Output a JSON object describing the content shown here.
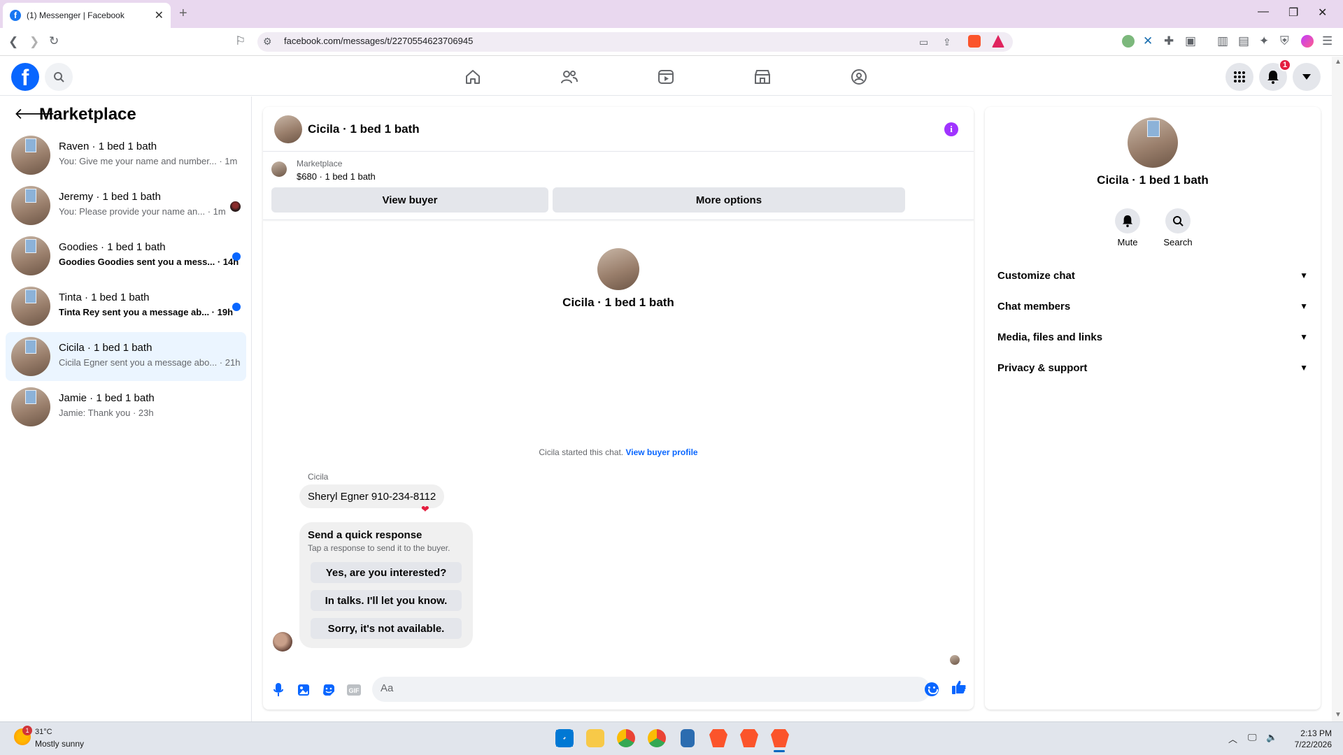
{
  "browser": {
    "tab_title": "(1) Messenger | Facebook",
    "url": "facebook.com/messages/t/2270554623706945"
  },
  "header": {
    "notification_count": "1"
  },
  "left_panel": {
    "title": "Marketplace",
    "conversations": [
      {
        "name": "Raven · 1 bed 1 bath",
        "preview": "You: Give me your name and number... · 1m",
        "unread": false
      },
      {
        "name": "Jeremy · 1 bed 1 bath",
        "preview": "You: Please provide your name an... · 1m",
        "unread": false
      },
      {
        "name": "Goodies · 1 bed 1 bath",
        "preview": "Goodies Goodies sent you a mess... · 14h",
        "unread": true
      },
      {
        "name": "Tinta · 1 bed 1 bath",
        "preview": "Tinta Rey sent you a message ab... · 19h",
        "unread": true
      },
      {
        "name": "Cicila · 1 bed 1 bath",
        "preview": "Cicila Egner sent you a message abo... · 21h",
        "unread": false
      },
      {
        "name": "Jamie · 1 bed 1 bath",
        "preview": "Jamie: Thank you · 23h",
        "unread": false
      }
    ]
  },
  "chat": {
    "title": "Cicila · 1 bed 1 bath",
    "marketplace_label": "Marketplace",
    "listing": "$680 · 1 bed 1 bath",
    "view_buyer": "View buyer",
    "more_options": "More options",
    "profile_name": "Cicila · 1 bed 1 bath",
    "started_text": "Cicila started this chat.",
    "view_buyer_profile": "View buyer profile",
    "sender": "Cicila",
    "message": "Sheryl Egner 910-234-8112",
    "quick_title": "Send a quick response",
    "quick_sub": "Tap a response to send it to the buyer.",
    "quick_responses": [
      "Yes, are you interested?",
      "In talks. I'll let you know.",
      "Sorry, it's not available."
    ],
    "composer_placeholder": "Aa"
  },
  "right_panel": {
    "name": "Cicila · 1 bed 1 bath",
    "mute": "Mute",
    "search": "Search",
    "sections": [
      "Customize chat",
      "Chat members",
      "Media, files and links",
      "Privacy & support"
    ]
  },
  "taskbar": {
    "weather_badge": "1",
    "temp": "31°C",
    "desc": "Mostly sunny",
    "time": "2:13 PM",
    "date": "7/22/2026"
  },
  "colors": {
    "accent": "#0866ff",
    "active_row": "#ebf5ff",
    "info": "#a033ff",
    "notification": "#e41e3f"
  }
}
